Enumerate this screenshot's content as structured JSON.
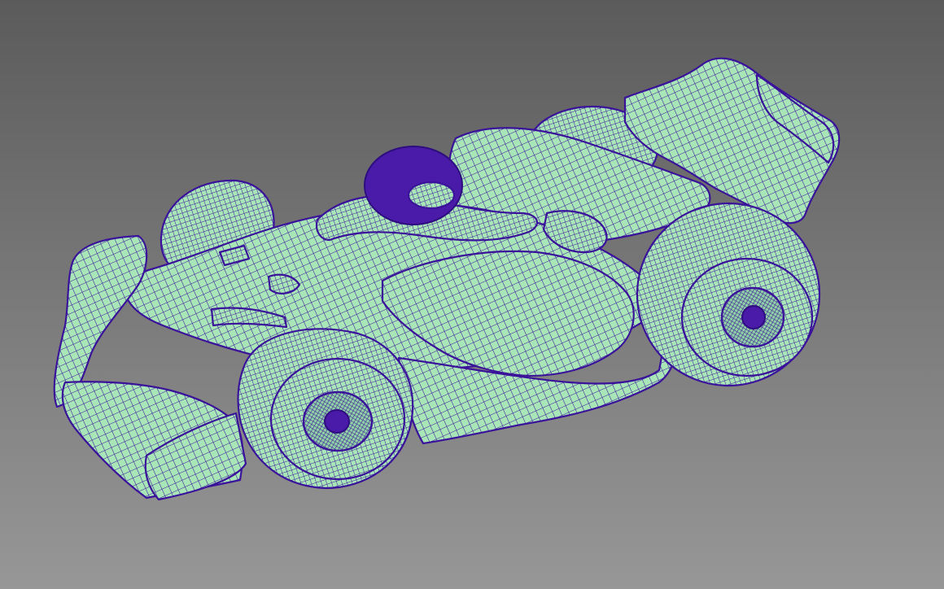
{
  "viewport": {
    "background_top": "#5b5b5b",
    "background_bottom": "#979797",
    "mesh_fill": "#a8e6b8",
    "wire_color": "#3a139a",
    "display_mode": "wireframe-on-shaded"
  },
  "model": {
    "icon": "race-car-mesh"
  }
}
